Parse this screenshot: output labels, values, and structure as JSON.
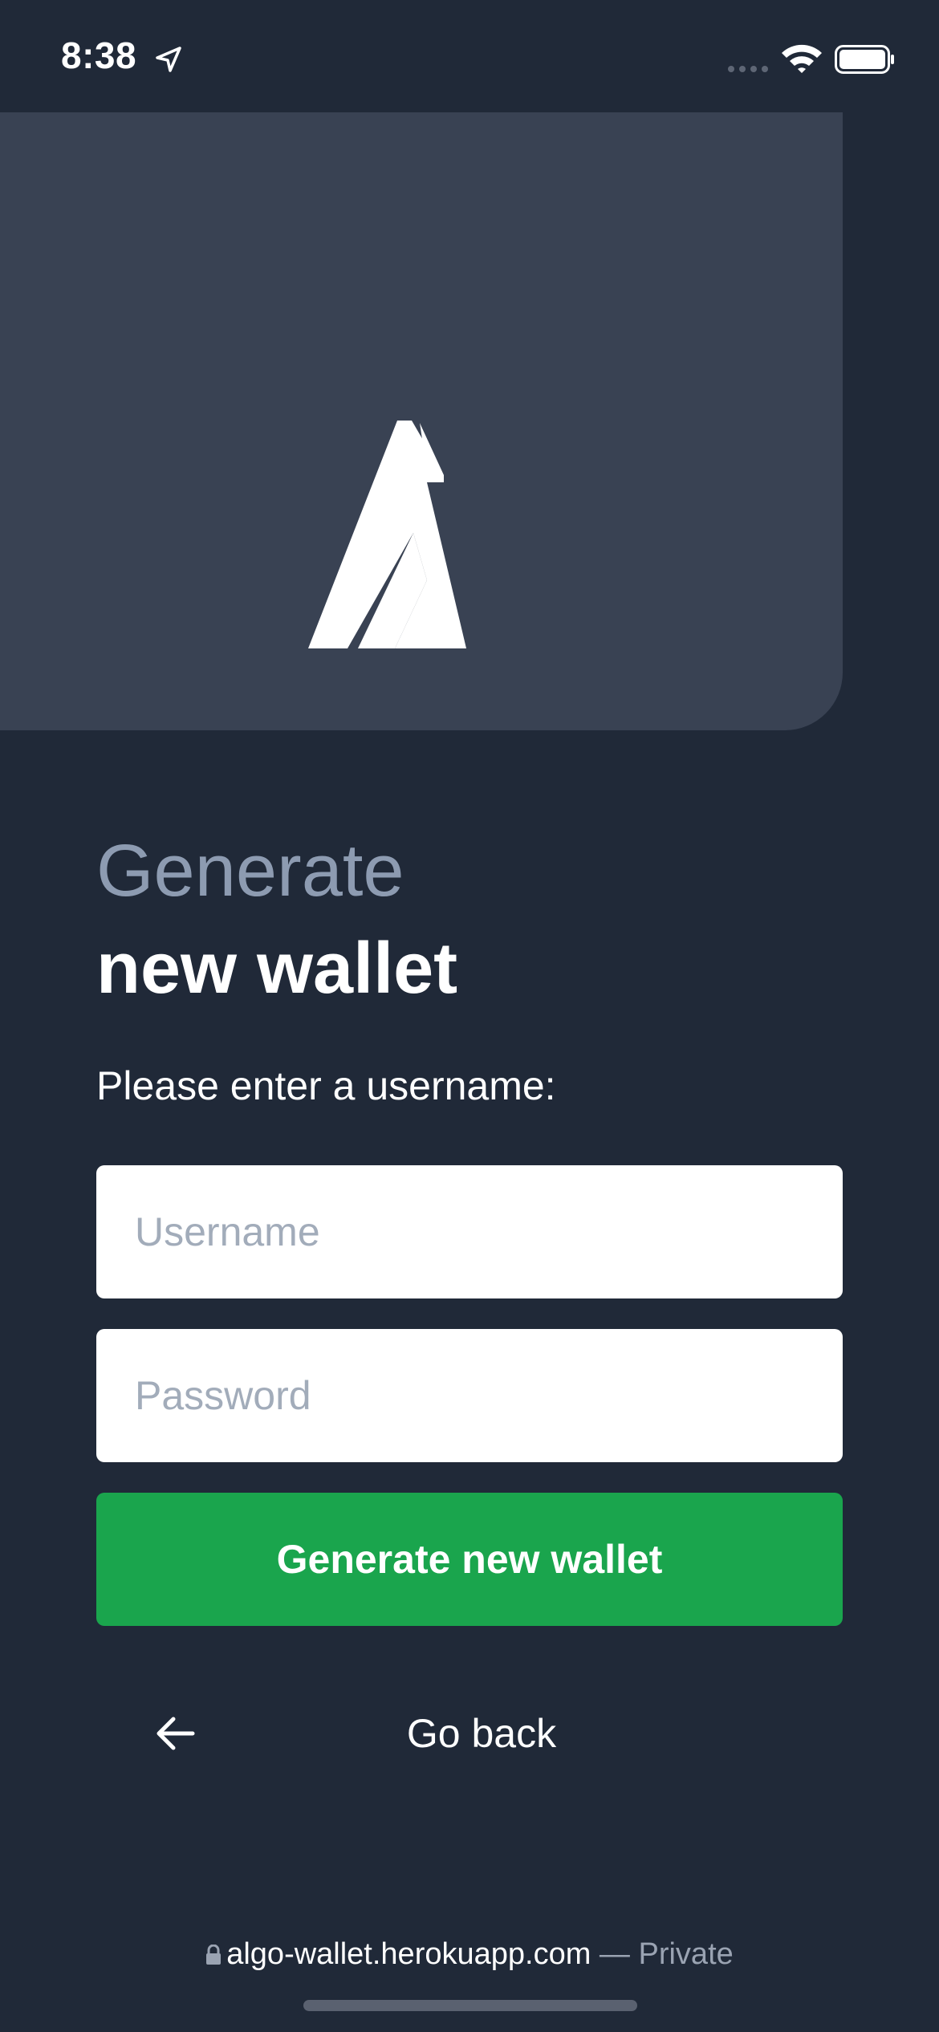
{
  "status_bar": {
    "time": "8:38"
  },
  "heading": {
    "line1": "Generate",
    "line2": "new wallet"
  },
  "form": {
    "prompt": "Please enter a username:",
    "username_placeholder": "Username",
    "password_placeholder": "Password",
    "submit_label": "Generate new wallet"
  },
  "navigation": {
    "back_label": "Go back"
  },
  "browser": {
    "domain": "algo-wallet.herokuapp.com",
    "mode": " — Private"
  },
  "colors": {
    "background": "#202938",
    "hero_card": "#394253",
    "primary_button": "#1aa54d",
    "muted_heading": "#8d9bb1"
  },
  "icons": [
    "location-arrow-icon",
    "signal-icon",
    "wifi-icon",
    "battery-icon",
    "algorand-logo",
    "arrow-left-icon",
    "lock-icon"
  ]
}
